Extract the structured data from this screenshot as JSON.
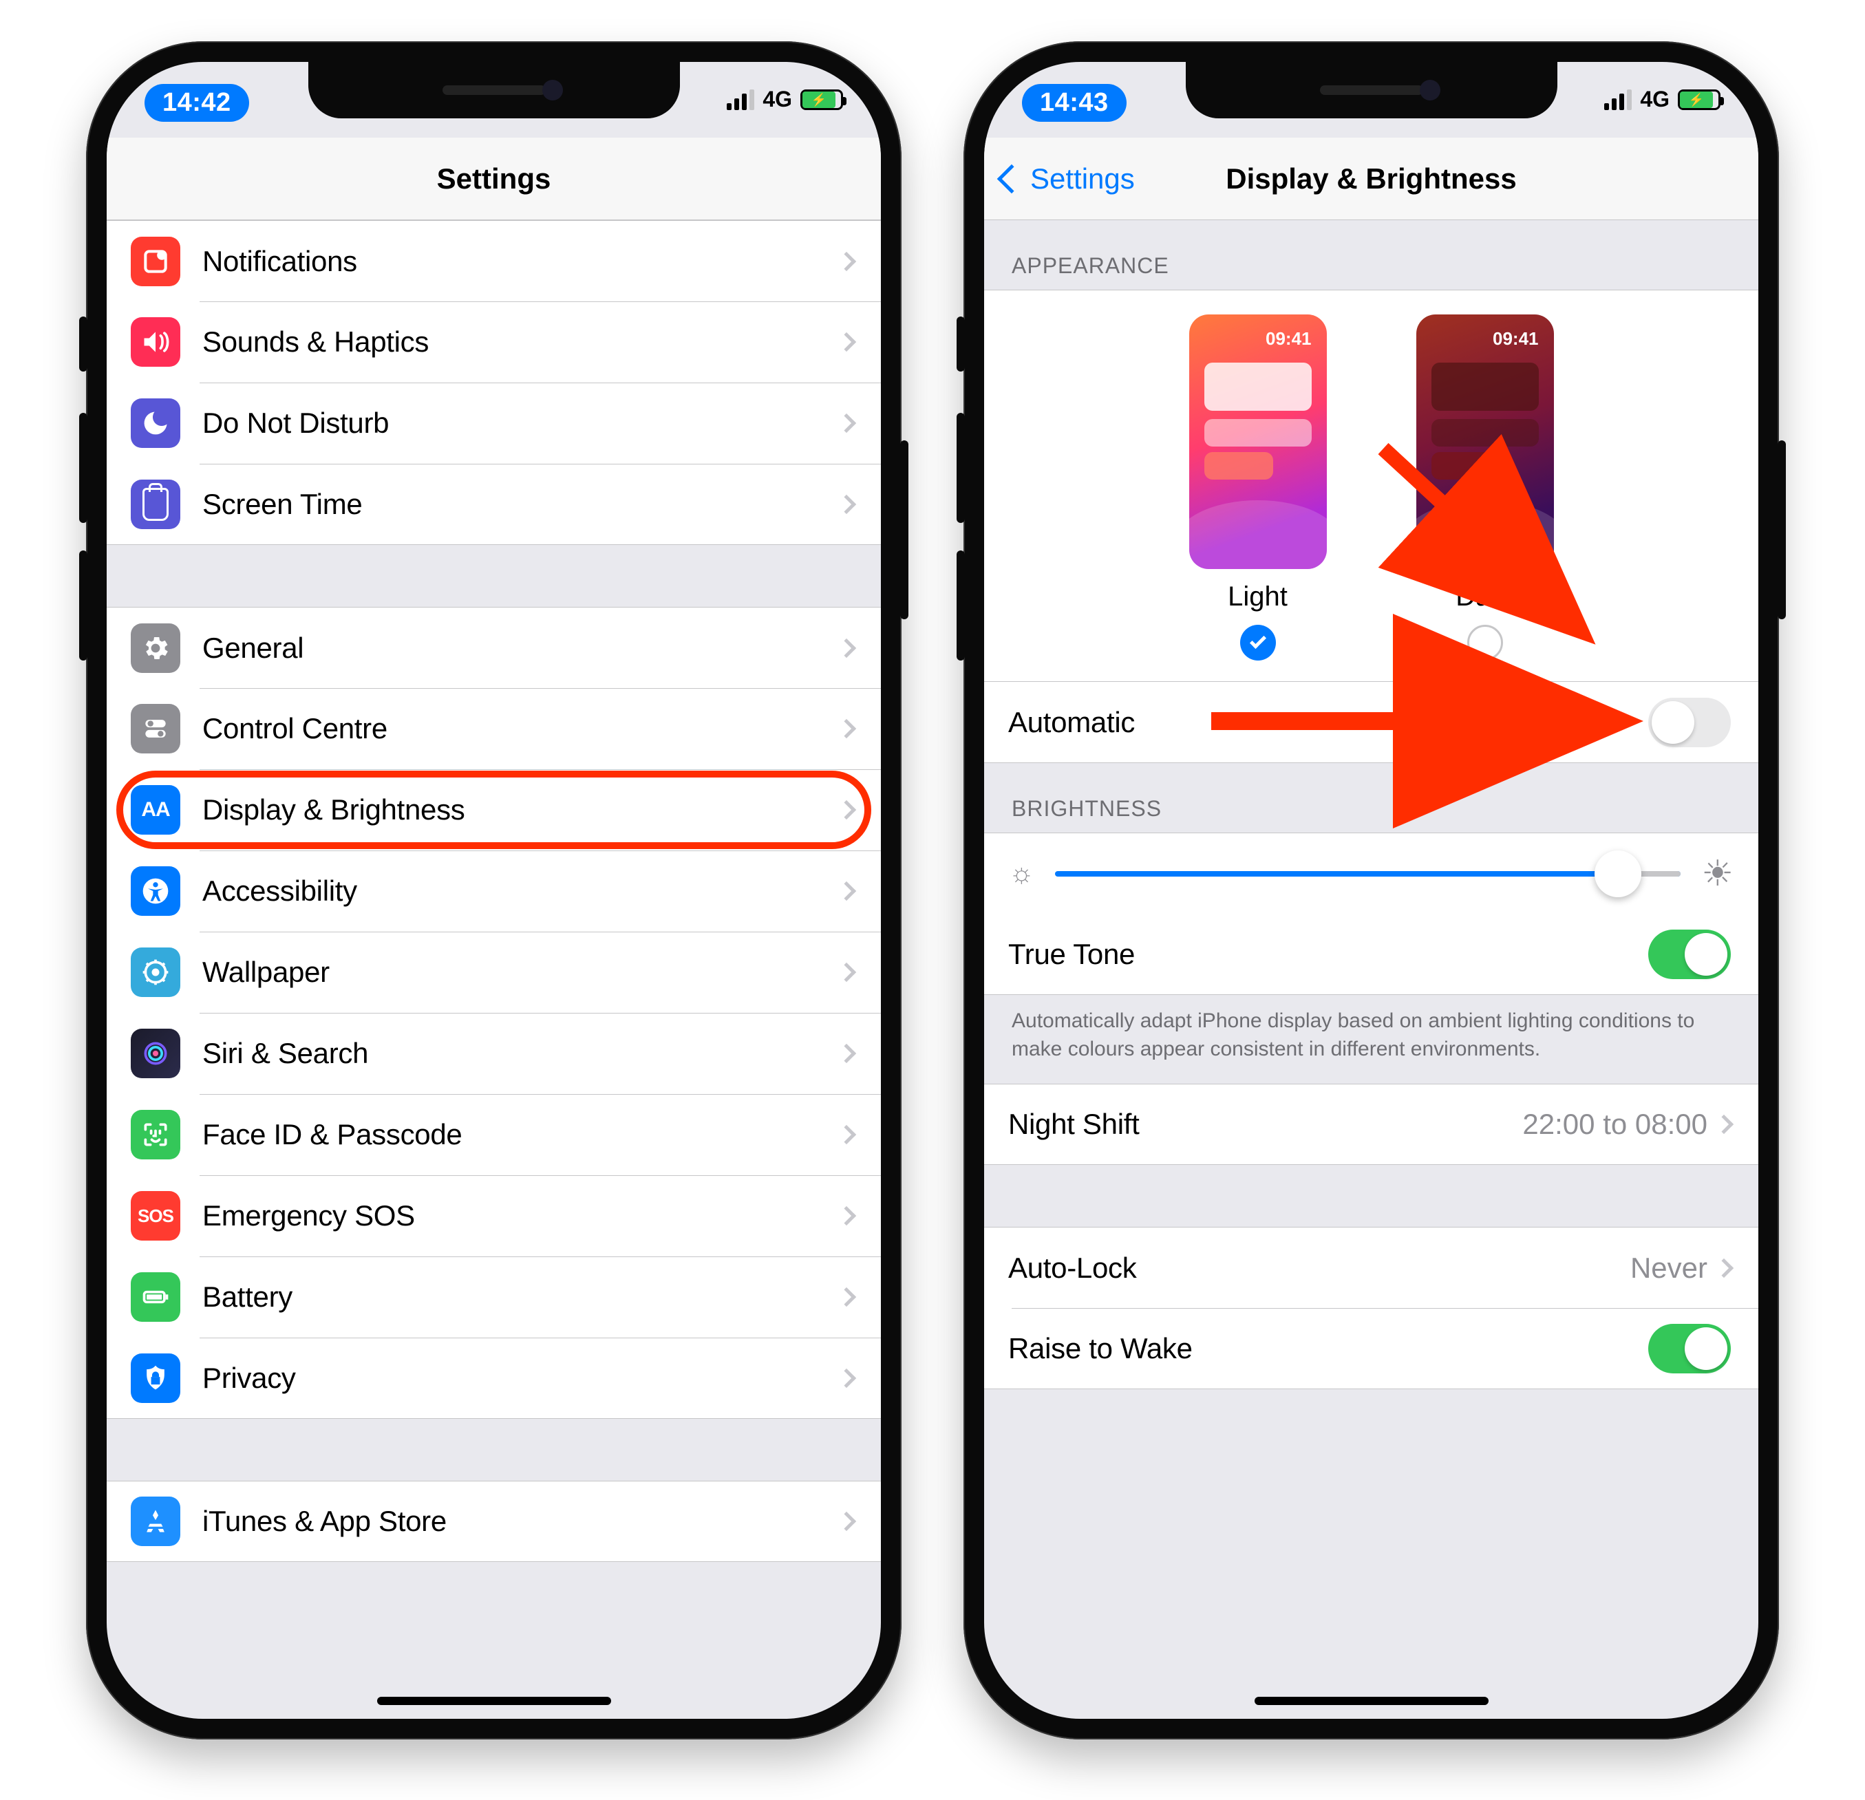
{
  "left": {
    "status": {
      "time": "14:42",
      "network": "4G"
    },
    "nav_title": "Settings",
    "groups": [
      [
        {
          "key": "notifications",
          "label": "Notifications",
          "icon": "notif"
        },
        {
          "key": "sounds",
          "label": "Sounds & Haptics",
          "icon": "sound"
        },
        {
          "key": "dnd",
          "label": "Do Not Disturb",
          "icon": "dnd"
        },
        {
          "key": "screen-time",
          "label": "Screen Time",
          "icon": "screentime"
        }
      ],
      [
        {
          "key": "general",
          "label": "General",
          "icon": "general"
        },
        {
          "key": "control-centre",
          "label": "Control Centre",
          "icon": "cc"
        },
        {
          "key": "display",
          "label": "Display & Brightness",
          "icon": "display",
          "highlighted": true
        },
        {
          "key": "accessibility",
          "label": "Accessibility",
          "icon": "access"
        },
        {
          "key": "wallpaper",
          "label": "Wallpaper",
          "icon": "wall"
        },
        {
          "key": "siri",
          "label": "Siri & Search",
          "icon": "siri"
        },
        {
          "key": "faceid",
          "label": "Face ID & Passcode",
          "icon": "faceid"
        },
        {
          "key": "sos",
          "label": "Emergency SOS",
          "icon": "sos"
        },
        {
          "key": "battery",
          "label": "Battery",
          "icon": "battery"
        },
        {
          "key": "privacy",
          "label": "Privacy",
          "icon": "privacy"
        }
      ],
      [
        {
          "key": "appstore",
          "label": "iTunes & App Store",
          "icon": "appstore"
        }
      ]
    ]
  },
  "right": {
    "status": {
      "time": "14:43",
      "network": "4G"
    },
    "nav_back": "Settings",
    "nav_title": "Display & Brightness",
    "appearance": {
      "header": "APPEARANCE",
      "light_label": "Light",
      "dark_label": "Dark",
      "preview_time": "09:41",
      "selected": "light",
      "automatic_label": "Automatic",
      "automatic_on": false
    },
    "brightness": {
      "header": "BRIGHTNESS",
      "value_pct": 90,
      "truetone_label": "True Tone",
      "truetone_on": true,
      "footer": "Automatically adapt iPhone display based on ambient lighting conditions to make colours appear consistent in different environments."
    },
    "night_shift": {
      "label": "Night Shift",
      "value": "22:00 to 08:00"
    },
    "auto_lock": {
      "label": "Auto-Lock",
      "value": "Never"
    },
    "raise_to_wake": {
      "label": "Raise to Wake",
      "on": true
    }
  },
  "icons": {
    "sos_text": "SOS",
    "display_text": "AA"
  }
}
